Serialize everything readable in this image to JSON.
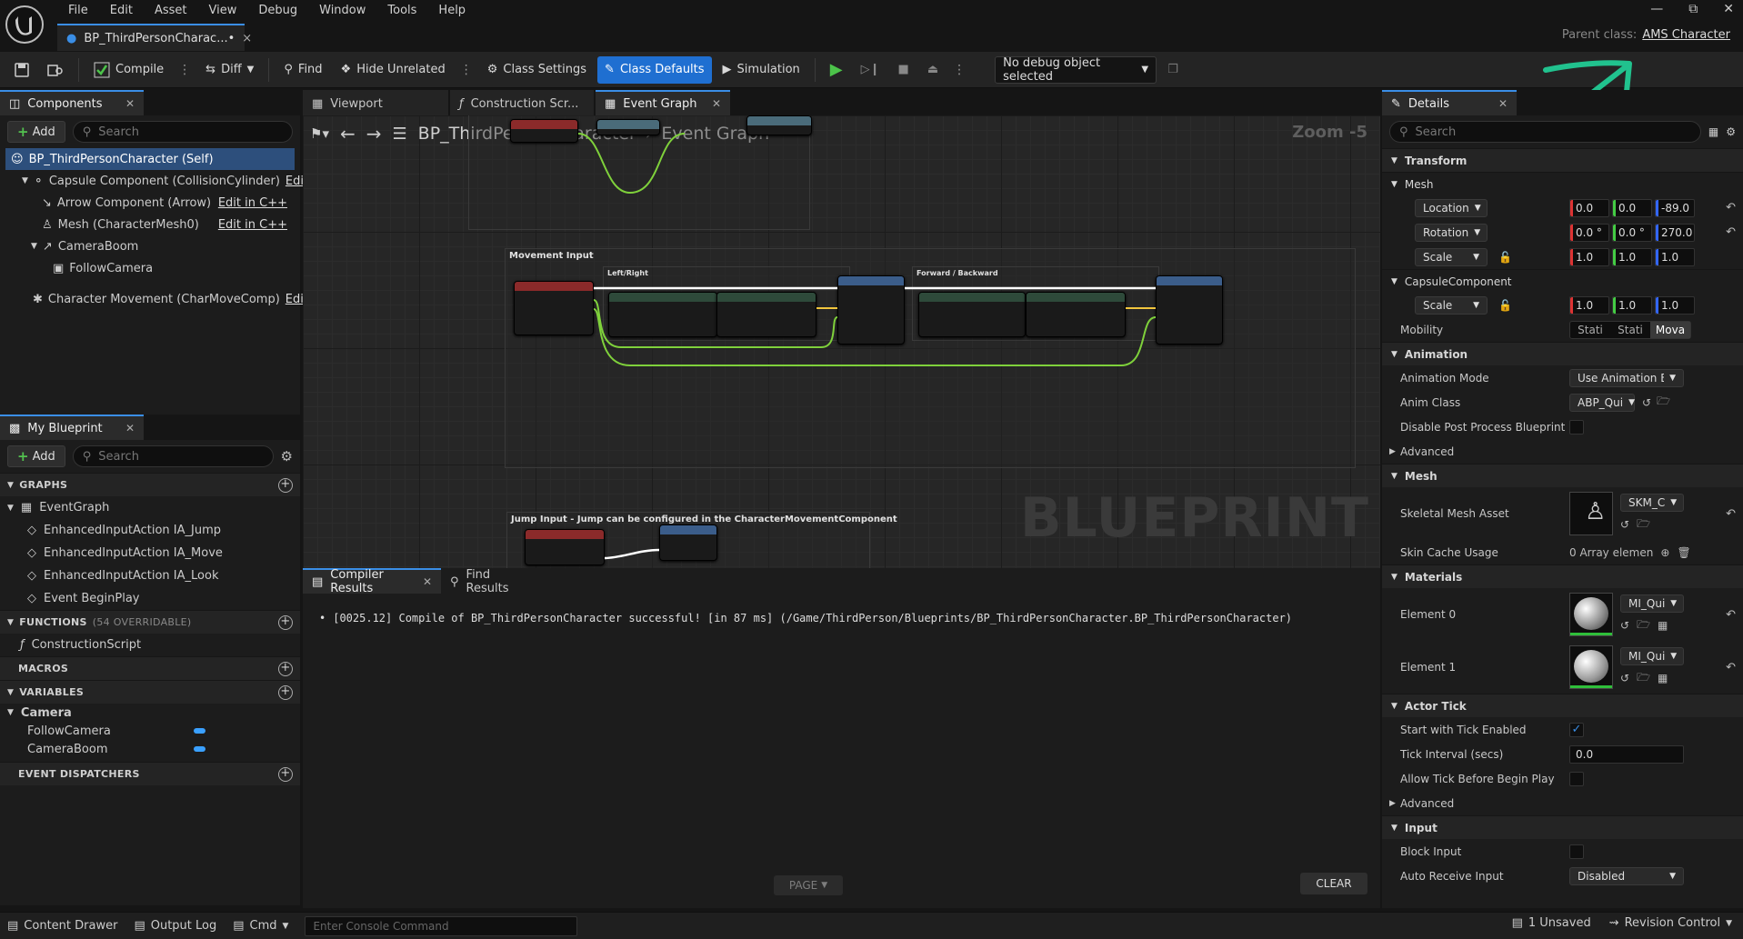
{
  "menu": [
    "File",
    "Edit",
    "Asset",
    "View",
    "Debug",
    "Window",
    "Tools",
    "Help"
  ],
  "doc_tab": {
    "label": "BP_ThirdPersonCharac...•",
    "close": "×"
  },
  "parent_class": {
    "label": "Parent class:",
    "value": "AMS Character"
  },
  "toolbar": {
    "compile": "Compile",
    "diff": "Diff",
    "find": "Find",
    "hide_unrelated": "Hide Unrelated",
    "class_settings": "Class Settings",
    "class_defaults": "Class Defaults",
    "simulation": "Simulation",
    "debug_object": "No debug object selected"
  },
  "components": {
    "tab": "Components",
    "add": "Add",
    "search_placeholder": "Search",
    "items": [
      {
        "label": "BP_ThirdPersonCharacter (Self)",
        "edit": ""
      },
      {
        "label": "Capsule Component (CollisionCylinder)",
        "edit": "Edit in"
      },
      {
        "label": "Arrow Component (Arrow)",
        "edit": "Edit in C++"
      },
      {
        "label": "Mesh (CharacterMesh0)",
        "edit": "Edit in C++"
      },
      {
        "label": "CameraBoom",
        "edit": ""
      },
      {
        "label": "FollowCamera",
        "edit": ""
      },
      {
        "label": "Character Movement (CharMoveComp)",
        "edit": "Edit ir"
      }
    ]
  },
  "my_blueprint": {
    "tab": "My Blueprint",
    "add": "Add",
    "search_placeholder": "Search",
    "graphs_hdr": "GRAPHS",
    "graphs": [
      "EventGraph",
      "EnhancedInputAction IA_Jump",
      "EnhancedInputAction IA_Move",
      "EnhancedInputAction IA_Look",
      "Event BeginPlay"
    ],
    "functions_hdr": "FUNCTIONS",
    "functions_count": "(54 OVERRIDABLE)",
    "functions": [
      "ConstructionScript"
    ],
    "macros_hdr": "MACROS",
    "variables_hdr": "VARIABLES",
    "var_category": "Camera",
    "variables": [
      "FollowCamera",
      "CameraBoom"
    ],
    "dispatchers_hdr": "EVENT DISPATCHERS"
  },
  "center_tabs": [
    "Viewport",
    "Construction Scr...",
    "Event Graph"
  ],
  "graph": {
    "breadcrumb_root": "BP_ThirdPersonCharacter",
    "breadcrumb_leaf": "Event Graph",
    "zoom": "Zoom -5",
    "watermark": "BLUEPRINT",
    "comment_movement": "Movement Input",
    "comment_leftright": "Left/Right",
    "comment_forward": "Forward / Backward",
    "comment_jump": "Jump Input - Jump can be configured in the CharacterMovementComponent"
  },
  "results": {
    "tab_compiler": "Compiler Results",
    "tab_find": "Find Results",
    "message": "[0025.12] Compile of BP_ThirdPersonCharacter successful! [in 87 ms] (/Game/ThirdPerson/Blueprints/BP_ThirdPersonCharacter.BP_ThirdPersonCharacter)",
    "page": "PAGE",
    "clear": "CLEAR"
  },
  "details": {
    "tab": "Details",
    "search_placeholder": "Search",
    "transform": "Transform",
    "mesh_sub": "Mesh",
    "location": "Location",
    "location_vals": [
      "0.0",
      "0.0",
      "-89.0"
    ],
    "rotation": "Rotation",
    "rotation_vals": [
      "0.0 °",
      "0.0 °",
      "270.0"
    ],
    "scale": "Scale",
    "scale_vals": [
      "1.0",
      "1.0",
      "1.0"
    ],
    "capsule": "CapsuleComponent",
    "capsule_scale_vals": [
      "1.0",
      "1.0",
      "1.0"
    ],
    "mobility": "Mobility",
    "mobility_opts": [
      "Stati",
      "Stati",
      "Mova"
    ],
    "animation": "Animation",
    "anim_mode": "Animation Mode",
    "anim_mode_val": "Use Animation Blu",
    "anim_class": "Anim Class",
    "anim_class_val": "ABP_Qui",
    "disable_post": "Disable Post Process Blueprint",
    "advanced": "Advanced",
    "mesh_sec": "Mesh",
    "skeletal_mesh": "Skeletal Mesh Asset",
    "skeletal_mesh_val": "SKM_C",
    "skin_cache": "Skin Cache Usage",
    "skin_cache_val": "0 Array elemen",
    "materials": "Materials",
    "element0": "Element 0",
    "element0_val": "MI_Qui",
    "element1": "Element 1",
    "element1_val": "MI_Qui",
    "actor_tick": "Actor Tick",
    "start_tick": "Start with Tick Enabled",
    "tick_interval": "Tick Interval (secs)",
    "tick_interval_val": "0.0",
    "allow_tick": "Allow Tick Before Begin Play",
    "advanced2": "Advanced",
    "input": "Input",
    "block_input": "Block Input",
    "auto_receive": "Auto Receive Input",
    "auto_receive_val": "Disabled"
  },
  "status": {
    "content_drawer": "Content Drawer",
    "output_log": "Output Log",
    "cmd": "Cmd",
    "console_placeholder": "Enter Console Command",
    "unsaved": "1 Unsaved",
    "revision": "Revision Control"
  },
  "colors": {
    "accent": "#1f6fd1",
    "annotation_arrow": "#21c28e",
    "exec_wire": "#ffffff",
    "data_wire": "#7fd13b"
  }
}
